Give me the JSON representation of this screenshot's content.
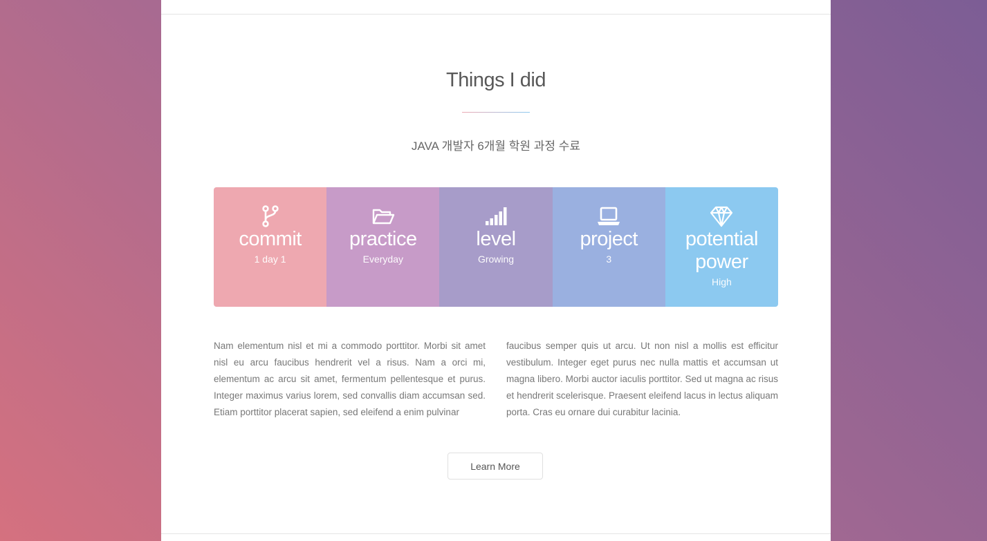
{
  "section": {
    "title": "Things I did",
    "subtitle": "JAVA 개발자 6개월 학원 과정 수료"
  },
  "stats": [
    {
      "icon": "code-branch-icon",
      "label": "commit",
      "value": "1 day 1",
      "color": "#eea8b0"
    },
    {
      "icon": "folder-open-icon",
      "label": "practice",
      "value": "Everyday",
      "color": "#c79bc8"
    },
    {
      "icon": "signal-bars-icon",
      "label": "level",
      "value": "Growing",
      "color": "#a79cc9"
    },
    {
      "icon": "laptop-icon",
      "label": "project",
      "value": "3",
      "color": "#9ab0e0"
    },
    {
      "icon": "diamond-icon",
      "label": "potential power",
      "value": "High",
      "color": "#8cc9f0"
    }
  ],
  "paragraphs": {
    "left": "Nam elementum nisl et mi a commodo porttitor. Morbi sit amet nisl eu arcu faucibus hendrerit vel a risus. Nam a orci mi, elementum ac arcu sit amet, fermentum pellentesque et purus. Integer maximus varius lorem, sed convallis diam accumsan sed. Etiam porttitor placerat sapien, sed eleifend a enim pulvinar",
    "right": "faucibus semper quis ut arcu. Ut non nisl a mollis est efficitur vestibulum. Integer eget purus nec nulla mattis et accumsan ut magna libero. Morbi auctor iaculis porttitor. Sed ut magna ac risus et hendrerit scelerisque. Praesent eleifend lacus in lectus aliquam porta. Cras eu ornare dui curabitur lacinia."
  },
  "cta": {
    "label": "Learn More"
  }
}
